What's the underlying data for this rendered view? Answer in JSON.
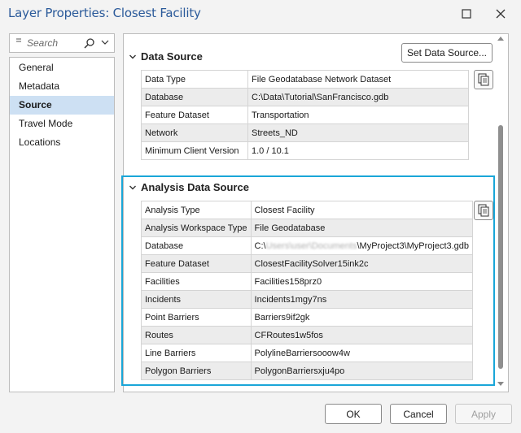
{
  "window": {
    "title": "Layer Properties: Closest Facility"
  },
  "sidebar": {
    "search_placeholder": "Search",
    "items": [
      {
        "label": "General",
        "active": false
      },
      {
        "label": "Metadata",
        "active": false
      },
      {
        "label": "Source",
        "active": true
      },
      {
        "label": "Travel Mode",
        "active": false
      },
      {
        "label": "Locations",
        "active": false
      }
    ]
  },
  "data_source": {
    "heading": "Data Source",
    "set_button": "Set Data Source...",
    "rows": [
      {
        "key": "Data Type",
        "value": "File Geodatabase Network Dataset"
      },
      {
        "key": "Database",
        "value": "C:\\Data\\Tutorial\\SanFrancisco.gdb"
      },
      {
        "key": "Feature Dataset",
        "value": "Transportation"
      },
      {
        "key": "Network",
        "value": "Streets_ND"
      },
      {
        "key": "Minimum Client Version",
        "value": "1.0 / 10.1"
      }
    ]
  },
  "analysis_source": {
    "heading": "Analysis Data Source",
    "rows": [
      {
        "key": "Analysis Type",
        "value": "Closest Facility"
      },
      {
        "key": "Analysis Workspace Type",
        "value": "File Geodatabase"
      },
      {
        "key": "Database",
        "value_prefix": "C:\\",
        "value_blurred": "Users\\user\\Documents",
        "value_suffix": "\\MyProject3\\MyProject3.gdb"
      },
      {
        "key": "Feature Dataset",
        "value": "ClosestFacilitySolver15ink2c"
      },
      {
        "key": "Facilities",
        "value": "Facilities158prz0"
      },
      {
        "key": "Incidents",
        "value": "Incidents1mgy7ns"
      },
      {
        "key": "Point Barriers",
        "value": "Barriers9if2gk"
      },
      {
        "key": "Routes",
        "value": "CFRoutes1w5fos"
      },
      {
        "key": "Line Barriers",
        "value": "PolylineBarriersooow4w"
      },
      {
        "key": "Polygon Barriers",
        "value": "PolygonBarriersxju4po"
      }
    ]
  },
  "footer": {
    "ok": "OK",
    "cancel": "Cancel",
    "apply": "Apply"
  },
  "colors": {
    "title": "#2b5a9a",
    "selection": "#cde0f3",
    "highlight_border": "#1aa6d8"
  },
  "icons": [
    "close-icon",
    "maximize-icon",
    "search-icon",
    "magnifier-icon",
    "chevron-down-icon",
    "copy-icon",
    "scroll-up-icon",
    "scroll-down-icon"
  ]
}
